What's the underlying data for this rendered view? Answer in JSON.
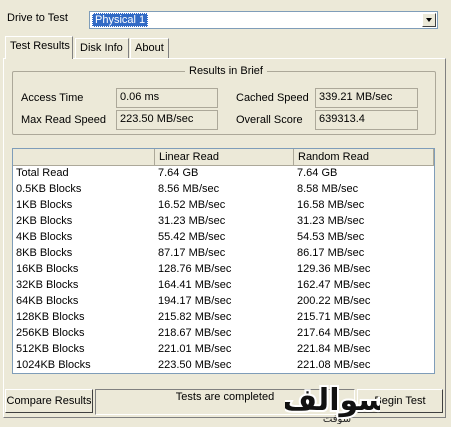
{
  "drive": {
    "label": "Drive to Test",
    "value": "Physical 1"
  },
  "tabs": [
    {
      "label": "Test Results",
      "active": true
    },
    {
      "label": "Disk Info",
      "active": false
    },
    {
      "label": "About",
      "active": false
    }
  ],
  "brief": {
    "title": "Results in Brief",
    "access_time_label": "Access Time",
    "access_time": "0.06 ms",
    "cached_speed_label": "Cached Speed",
    "cached_speed": "339.21 MB/sec",
    "max_read_label": "Max Read Speed",
    "max_read": "223.50 MB/sec",
    "overall_score_label": "Overall Score",
    "overall_score": "639313.4"
  },
  "table": {
    "headers": [
      "",
      "Linear Read",
      "Random Read"
    ],
    "rows": [
      [
        "Total Read",
        "7.64 GB",
        "7.64 GB"
      ],
      [
        "0.5KB Blocks",
        "8.56 MB/sec",
        "8.58 MB/sec"
      ],
      [
        "1KB Blocks",
        "16.52 MB/sec",
        "16.58 MB/sec"
      ],
      [
        "2KB Blocks",
        "31.23 MB/sec",
        "31.23 MB/sec"
      ],
      [
        "4KB Blocks",
        "55.42 MB/sec",
        "54.53 MB/sec"
      ],
      [
        "8KB Blocks",
        "87.17 MB/sec",
        "86.17 MB/sec"
      ],
      [
        "16KB Blocks",
        "128.76 MB/sec",
        "129.36 MB/sec"
      ],
      [
        "32KB Blocks",
        "164.41 MB/sec",
        "162.47 MB/sec"
      ],
      [
        "64KB Blocks",
        "194.17 MB/sec",
        "200.22 MB/sec"
      ],
      [
        "128KB Blocks",
        "215.82 MB/sec",
        "215.71 MB/sec"
      ],
      [
        "256KB Blocks",
        "218.67 MB/sec",
        "217.64 MB/sec"
      ],
      [
        "512KB Blocks",
        "221.01 MB/sec",
        "221.84 MB/sec"
      ],
      [
        "1024KB Blocks",
        "223.50 MB/sec",
        "221.08 MB/sec"
      ]
    ]
  },
  "footer": {
    "compare_label": "Compare Results",
    "status": "Tests are completed",
    "begin_label": "Begin Test"
  },
  "logo": {
    "text_main": "سوالف",
    "text_sub": "سوفت"
  },
  "colors": {
    "window_bg": "#ece9d8",
    "selection": "#316ac5",
    "input_border": "#7f9db9"
  }
}
